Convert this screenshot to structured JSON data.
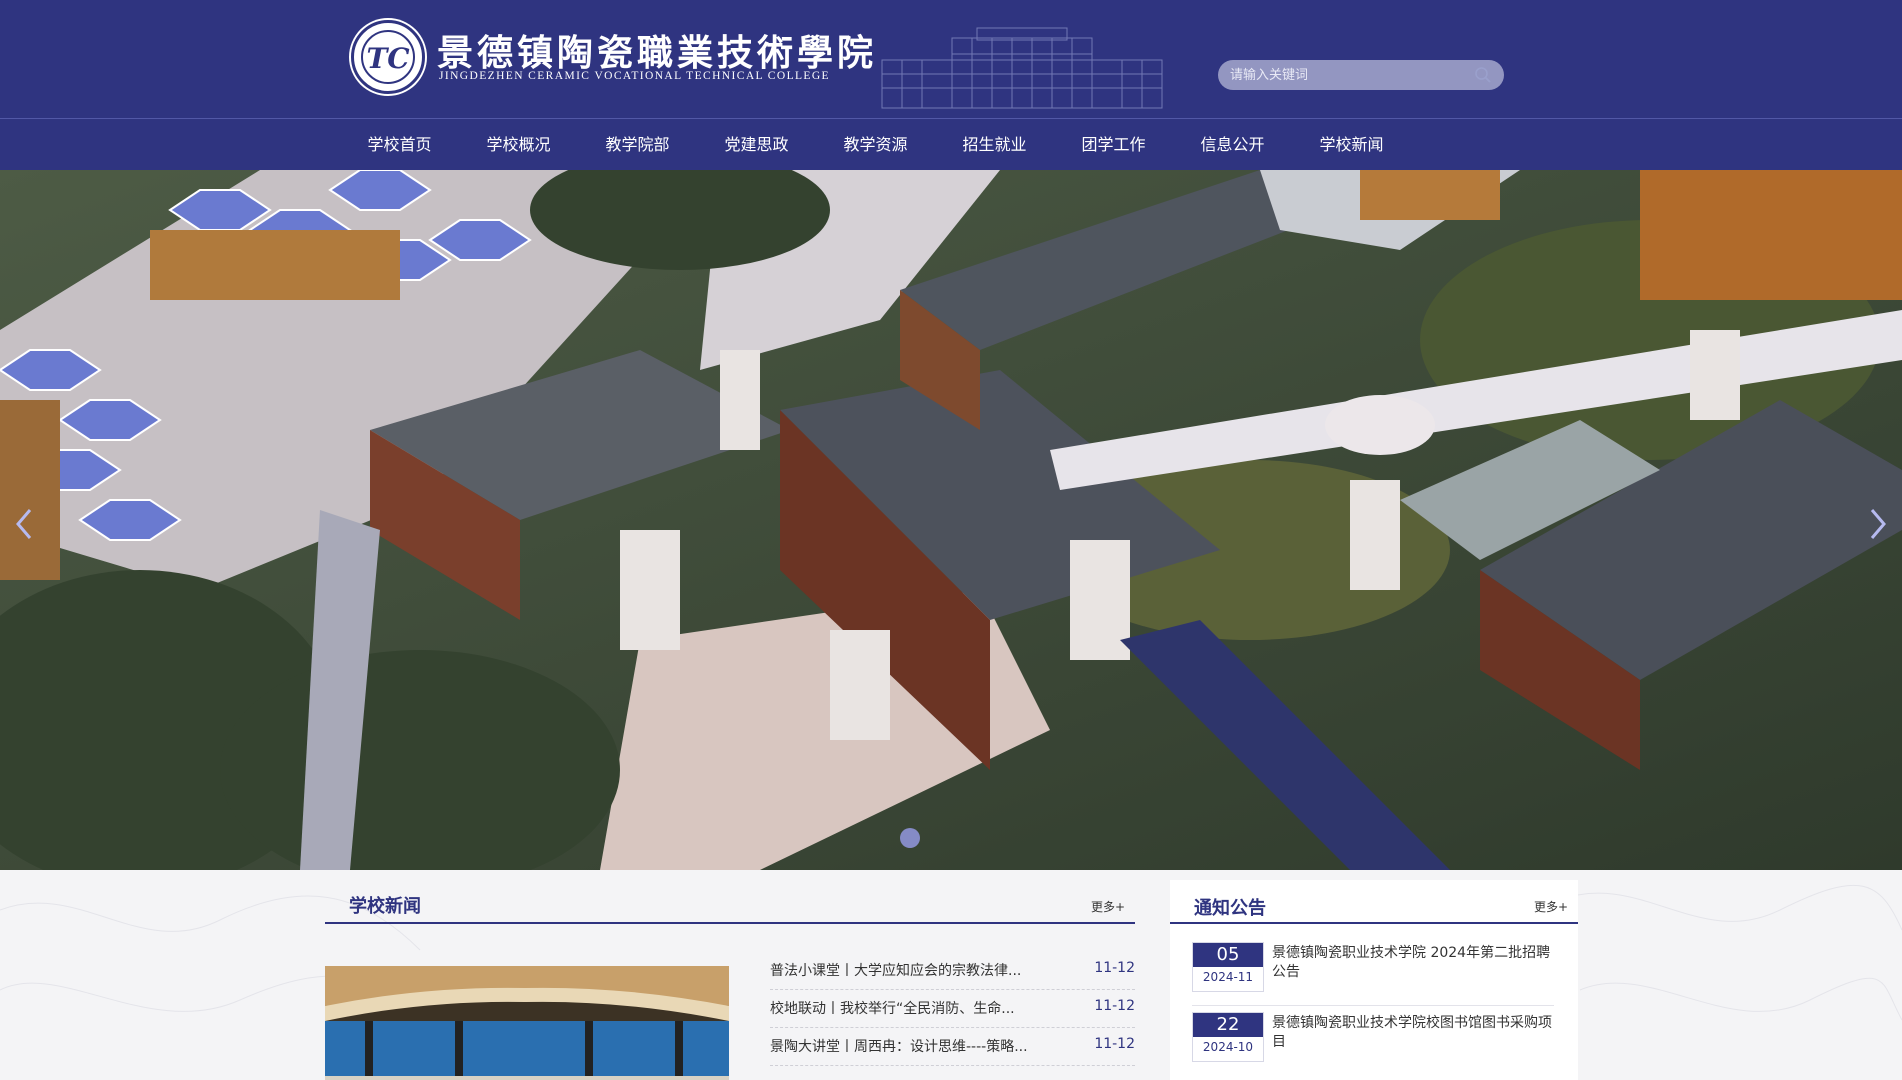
{
  "header": {
    "logo_cn": "景德镇陶瓷職業技術學院",
    "logo_en": "JINGDEZHEN  CERAMIC  VOCATIONAL  TECHNICAL  COLLEGE",
    "logo_mono": "TC"
  },
  "search": {
    "placeholder": "请输入关键词"
  },
  "nav": {
    "items": [
      "学校首页",
      "学校概况",
      "教学院部",
      "党建思政",
      "教学资源",
      "招生就业",
      "团学工作",
      "信息公开",
      "学校新闻"
    ]
  },
  "news": {
    "title": "学校新闻",
    "more": "更多+",
    "items": [
      {
        "title": "普法小课堂丨大学应知应会的宗教法律...",
        "date": "11-12"
      },
      {
        "title": "校地联动丨我校举行“全民消防、生命...",
        "date": "11-12"
      },
      {
        "title": "景陶大讲堂丨周西冉：设计思维----策略...",
        "date": "11-12"
      }
    ]
  },
  "notice": {
    "title": "通知公告",
    "more": "更多+",
    "items": [
      {
        "day": "05",
        "ym": "2024-11",
        "title": "景德镇陶瓷职业技术学院 2024年第二批招聘公告"
      },
      {
        "day": "22",
        "ym": "2024-10",
        "title": "景德镇陶瓷职业技术学院校图书馆图书采购项目"
      }
    ]
  },
  "colors": {
    "brand": "#2f3480",
    "date_text": "#2f3480"
  },
  "icons": {
    "search": "search-icon",
    "prev": "chevron-left-icon",
    "next": "chevron-right-icon"
  }
}
